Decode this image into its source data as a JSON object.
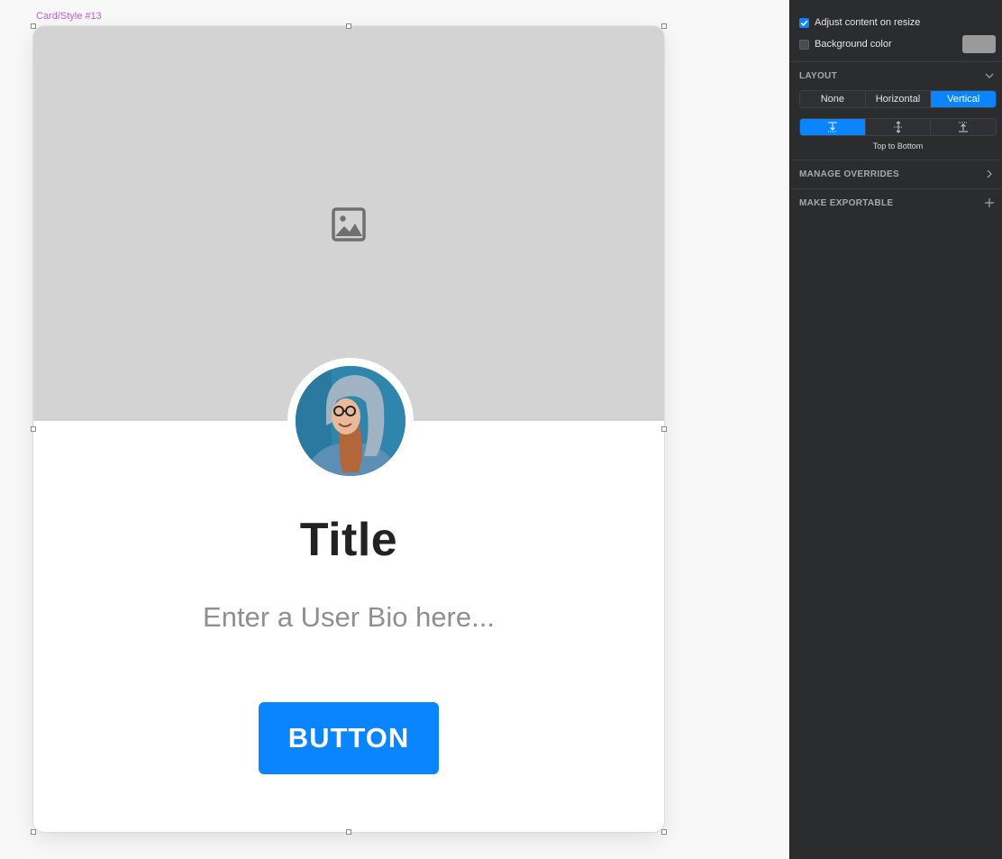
{
  "canvas": {
    "artboard_label": "Card/Style #13",
    "card": {
      "title": "Title",
      "bio": "Enter a User Bio here...",
      "button_label": "BUTTON",
      "image_icon": "image-placeholder-icon",
      "avatar": "user-avatar-photo"
    }
  },
  "inspector": {
    "adjust_content_label": "Adjust content on resize",
    "adjust_content_checked": true,
    "background_color_label": "Background color",
    "background_color_checked": false,
    "background_color_value": "#9a9a9a",
    "layout": {
      "title": "LAYOUT",
      "modes": [
        "None",
        "Horizontal",
        "Vertical"
      ],
      "selected_mode": "Vertical",
      "directions": [
        "top-to-bottom-icon",
        "middle-icon",
        "bottom-to-top-icon"
      ],
      "selected_direction_label": "Top to Bottom"
    },
    "manage_overrides_title": "MANAGE OVERRIDES",
    "make_exportable_title": "MAKE EXPORTABLE"
  },
  "colors": {
    "accent": "#0a84ff",
    "artboard_label": "#c65bd8",
    "image_placeholder": "#d3d3d3",
    "inspector_bg": "#2b2c2e"
  }
}
